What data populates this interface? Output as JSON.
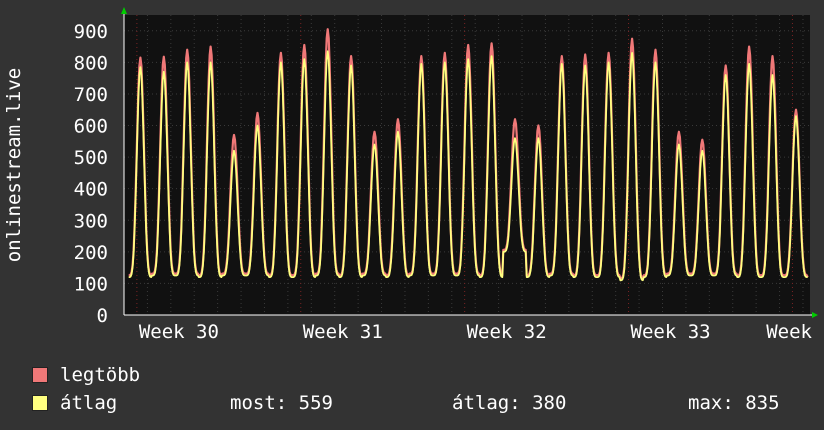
{
  "chart_data": {
    "type": "line",
    "ylabel": "onlinestream.live",
    "ylim": [
      0,
      950
    ],
    "yticks": [
      0,
      100,
      200,
      300,
      400,
      500,
      600,
      700,
      800,
      900
    ],
    "x_ticks": [
      "Week 30",
      "Week 31",
      "Week 32",
      "Week 33",
      "Week"
    ],
    "grid": true,
    "series": [
      {
        "name": "legtöbb",
        "color": "#f07878",
        "values": [
          815,
          818,
          840,
          850,
          570,
          640,
          830,
          855,
          905,
          820,
          580,
          620,
          820,
          830,
          855,
          860,
          620,
          600,
          820,
          825,
          830,
          875,
          840,
          580,
          555,
          790,
          850,
          820,
          650
        ]
      },
      {
        "name": "átlag",
        "color": "#ffff80",
        "values": [
          785,
          770,
          800,
          800,
          520,
          600,
          800,
          810,
          835,
          790,
          540,
          580,
          795,
          800,
          810,
          820,
          560,
          560,
          795,
          790,
          800,
          830,
          800,
          540,
          520,
          760,
          795,
          760,
          630
        ]
      }
    ],
    "daily_min": [
      120,
      125,
      125,
      120,
      125,
      125,
      120,
      120,
      125,
      120,
      125,
      120,
      125,
      125,
      125,
      120,
      200,
      120,
      125,
      120,
      120,
      110,
      120,
      125,
      125,
      125,
      120,
      120,
      120
    ]
  },
  "legend": {
    "max_label": "legtöbb",
    "avg_label": "átlag",
    "now_text": "most: 559",
    "avg_text": "átlag: 380",
    "max_text": "max: 835"
  },
  "colors": {
    "background": "#333333",
    "plot_background": "#111111",
    "grid": "#3a3a3a",
    "week_grid": "#7a2424",
    "axis_arrow": "#00cc00"
  }
}
